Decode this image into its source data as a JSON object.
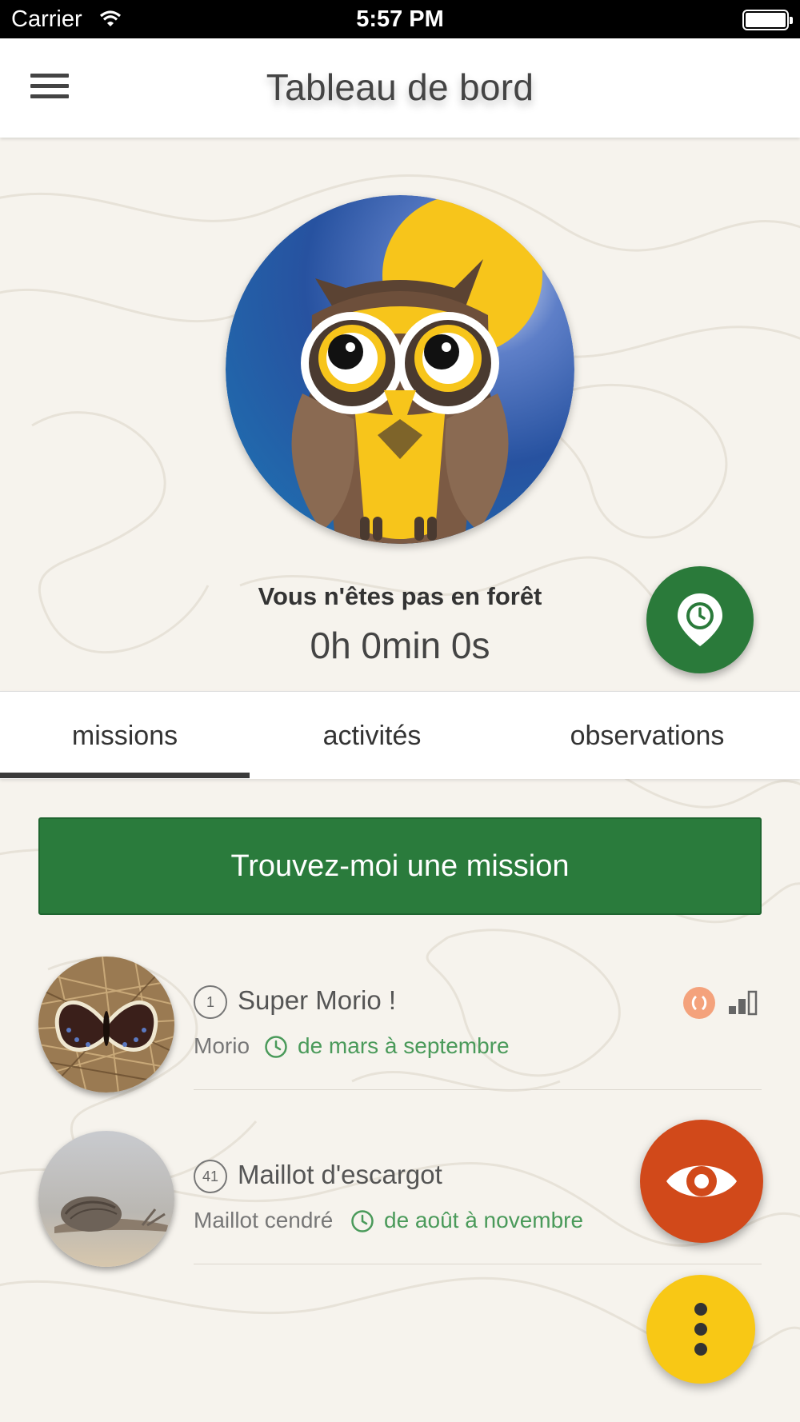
{
  "status_bar": {
    "carrier": "Carrier",
    "time": "5:57 PM"
  },
  "header": {
    "title": "Tableau de bord",
    "menu_icon": "hamburger-menu-icon"
  },
  "dashboard": {
    "forest_status": "Vous n'êtes pas en forêt",
    "timer": "0h 0min 0s",
    "location_button_icon": "map-pin-clock-icon"
  },
  "tabs": [
    {
      "label": "missions",
      "selected": true
    },
    {
      "label": "activités",
      "selected": false
    },
    {
      "label": "observations",
      "selected": false
    }
  ],
  "find_mission_label": "Trouvez-moi une mission",
  "missions": [
    {
      "number": "1",
      "title": "Super Morio !",
      "species": "Morio",
      "period": "de mars à septembre",
      "difficulty_icon": "difficulty-icon",
      "level_icon": "signal-level-icon"
    },
    {
      "number": "41",
      "title": "Maillot d'escargot",
      "species": "Maillot cendré",
      "period": "de août à novembre"
    }
  ],
  "fabs": {
    "observe_icon": "eye-icon",
    "more_icon": "more-vertical-icon"
  },
  "colors": {
    "primary_green": "#2a7b3c",
    "observe_orange": "#d1491a",
    "more_yellow": "#f8c815",
    "period_green": "#4a9a5a"
  }
}
